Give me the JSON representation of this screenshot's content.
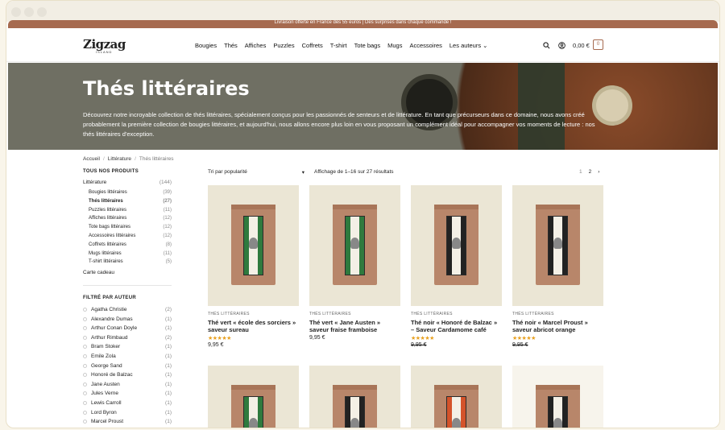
{
  "topbar": {
    "text": "Livraison offerte en France dès 55 euros | Des surprises dans chaque commande !"
  },
  "logo": {
    "name": "Zigzag",
    "sub": "ISLAND"
  },
  "nav": [
    "Bougies",
    "Thés",
    "Affiches",
    "Puzzles",
    "Coffrets",
    "T-shirt",
    "Tote bags",
    "Mugs",
    "Accessoires",
    "Les auteurs ⌄"
  ],
  "header": {
    "cart_total": "0,00 €",
    "cart_count": "0"
  },
  "hero": {
    "title": "Thés littéraires",
    "description": "Découvrez notre incroyable collection de thés littéraires, spécialement conçus pour les passionnés de senteurs et de littérature. En tant que précurseurs dans ce domaine, nous avons créé probablement la première collection de bougies littéraires, et aujourd'hui, nous allons encore plus loin en vous proposant un complément idéal pour accompagner vos moments de lecture : nos thés littéraires d'exception."
  },
  "breadcrumb": [
    "Accueil",
    "Littérature",
    "Thés littéraires"
  ],
  "sidebar": {
    "all_heading": "TOUS NOS PRODUITS",
    "main_category": {
      "label": "Littérature",
      "count": "(144)"
    },
    "subcategories": [
      {
        "label": "Bougies littéraires",
        "count": "(39)"
      },
      {
        "label": "Thés littéraires",
        "count": "(27)"
      },
      {
        "label": "Puzzles littéraires",
        "count": "(11)"
      },
      {
        "label": "Affiches littéraires",
        "count": "(12)"
      },
      {
        "label": "Tote bags littéraires",
        "count": "(12)"
      },
      {
        "label": "Accessoires littéraires",
        "count": "(12)"
      },
      {
        "label": "Coffrets littéraires",
        "count": "(8)"
      },
      {
        "label": "Mugs littéraires",
        "count": "(11)"
      },
      {
        "label": "T-shirt littéraires",
        "count": "(5)"
      }
    ],
    "gift_card": "Carte cadeau",
    "author_heading": "FILTRÉ PAR AUTEUR",
    "authors": [
      {
        "label": "Agatha Christie",
        "count": "(2)"
      },
      {
        "label": "Alexandre Dumas",
        "count": "(1)"
      },
      {
        "label": "Arthur Conan Doyle",
        "count": "(1)"
      },
      {
        "label": "Arthur Rimbaud",
        "count": "(2)"
      },
      {
        "label": "Bram Stoker",
        "count": "(1)"
      },
      {
        "label": "Emile Zola",
        "count": "(1)"
      },
      {
        "label": "George Sand",
        "count": "(1)"
      },
      {
        "label": "Honoré de Balzac",
        "count": "(1)"
      },
      {
        "label": "Jane Austen",
        "count": "(1)"
      },
      {
        "label": "Jules Verne",
        "count": "(1)"
      },
      {
        "label": "Lewis Carroll",
        "count": "(1)"
      },
      {
        "label": "Lord Byron",
        "count": "(1)"
      },
      {
        "label": "Marcel Proust",
        "count": "(1)"
      }
    ]
  },
  "toolbar": {
    "sort": "Tri par popularité",
    "results": "Affichage de 1–16 sur 27 résultats",
    "pages": [
      "1",
      "2",
      "›"
    ]
  },
  "products": [
    {
      "category": "THÉS LITTÉRAIRES",
      "title": "Thé vert « école des sorciers » saveur sureau",
      "stars": "★★★★★",
      "price": "9,95 €",
      "strike": false,
      "color": "#2f7a3e"
    },
    {
      "category": "THÉS LITTÉRAIRES",
      "title": "Thé vert « Jane Austen » saveur fraise framboise",
      "stars": "",
      "price": "9,95 €",
      "strike": false,
      "color": "#2f7a3e"
    },
    {
      "category": "THÉS LITTÉRAIRES",
      "title": "Thé noir « Honoré de Balzac » – Saveur Cardamome café",
      "stars": "★★★★★",
      "price": "9,95 €",
      "strike": true,
      "color": "#222222"
    },
    {
      "category": "THÉS LITTÉRAIRES",
      "title": "Thé noir « Marcel Proust » saveur abricot orange",
      "stars": "★★★★★",
      "price": "9,95 €",
      "strike": true,
      "color": "#222222"
    }
  ],
  "products_row2": [
    {
      "color": "#2f7a3e"
    },
    {
      "color": "#222222"
    },
    {
      "color": "#d4532a"
    },
    {
      "color": "#222222"
    }
  ]
}
